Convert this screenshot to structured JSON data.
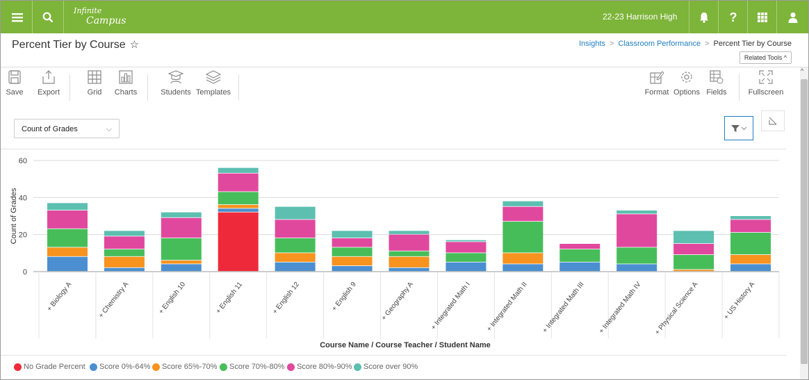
{
  "app": {
    "logo_line1": "Infinite",
    "logo_line2": "Campus",
    "school": "22-23 Harrison High"
  },
  "page": {
    "title": "Percent Tier by Course",
    "breadcrumbs": [
      "Insights",
      "Classroom Performance",
      "Percent Tier by Course"
    ],
    "related_tools": "Related Tools ^"
  },
  "toolbar": {
    "save": "Save",
    "export": "Export",
    "grid": "Grid",
    "charts": "Charts",
    "students": "Students",
    "templates": "Templates",
    "format": "Format",
    "options": "Options",
    "fields": "Fields",
    "fullscreen": "Fullscreen"
  },
  "measure_select": {
    "value": "Count of Grades"
  },
  "colors": {
    "topbar": "#7db43a",
    "link": "#1f7dc0"
  },
  "chart_data": {
    "type": "bar",
    "stacked": true,
    "xlabel": "Course Name / Course Teacher / Student Name",
    "ylabel": "Count of Grades",
    "ylim": [
      0,
      60
    ],
    "yticks": [
      0,
      20,
      40,
      60
    ],
    "grid": true,
    "legend_position": "bottom",
    "categories": [
      "+ Biology A",
      "+ Chemistry A",
      "+ English 10",
      "+ English 11",
      "+ English 12",
      "+ English 9",
      "+ Geography A",
      "+ Integrated Math I",
      "+ Integrated Math II",
      "+ Integrated Math III",
      "+ Integrated Math IV",
      "+ Physical Science A",
      "+ US History A"
    ],
    "series": [
      {
        "name": "No Grade Percent",
        "color": "#ee2a3a",
        "values": [
          0,
          0,
          0,
          32,
          0,
          0,
          0,
          0,
          0,
          0,
          0,
          0,
          0
        ]
      },
      {
        "name": "Score 0%-64%",
        "color": "#4b8fd0",
        "values": [
          8,
          2,
          4,
          2,
          5,
          3,
          2,
          5,
          4,
          5,
          4,
          0,
          4
        ]
      },
      {
        "name": "Score 65%-70%",
        "color": "#f7931e",
        "values": [
          5,
          6,
          2,
          2,
          5,
          5,
          6,
          0,
          6,
          0,
          0,
          1,
          5
        ]
      },
      {
        "name": "Score 70%-80%",
        "color": "#47bd5a",
        "values": [
          10,
          4,
          12,
          7,
          8,
          5,
          3,
          5,
          17,
          7,
          9,
          8,
          12
        ]
      },
      {
        "name": "Score 80%-90%",
        "color": "#e0489e",
        "values": [
          10,
          7,
          11,
          10,
          10,
          5,
          9,
          6,
          8,
          3,
          18,
          6,
          7
        ]
      },
      {
        "name": "Score over 90%",
        "color": "#5cbfb0",
        "values": [
          4,
          3,
          3,
          3,
          7,
          4,
          2,
          1,
          3,
          0,
          2,
          7,
          2
        ]
      }
    ]
  }
}
